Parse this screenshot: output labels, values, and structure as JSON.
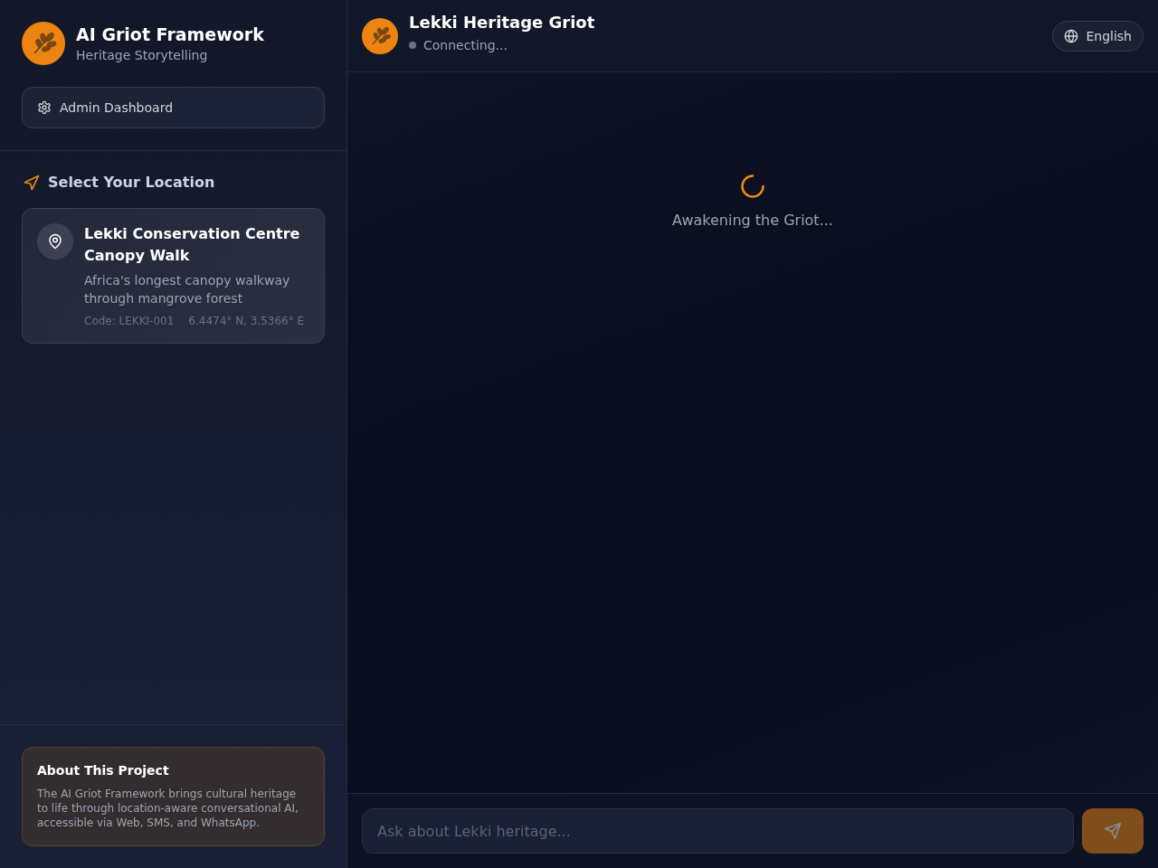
{
  "sidebar": {
    "brand": {
      "title": "AI Griot Framework",
      "subtitle": "Heritage Storytelling"
    },
    "admin_button": {
      "label": "Admin Dashboard"
    },
    "locations_heading": "Select Your Location",
    "locations": [
      {
        "name": "Lekki Conservation Centre Canopy Walk",
        "description": "Africa's longest canopy walkway through mangrove forest",
        "code": "Code: LEKKI-001",
        "coordinates": "6.4474° N, 3.5366° E",
        "selected": true
      }
    ],
    "about": {
      "title": "About This Project",
      "text": "The AI Griot Framework brings cultural heritage to life through location-aware conversational AI, accessible via Web, SMS, and WhatsApp."
    }
  },
  "chat": {
    "header": {
      "title": "Lekki Heritage Griot",
      "status": "Connecting...",
      "connected": false
    },
    "language_button": {
      "label": "English"
    },
    "loading": {
      "text": "Awakening the Griot..."
    },
    "composer": {
      "placeholder": "Ask about Lekki heritage...",
      "send_disabled": true
    }
  }
}
